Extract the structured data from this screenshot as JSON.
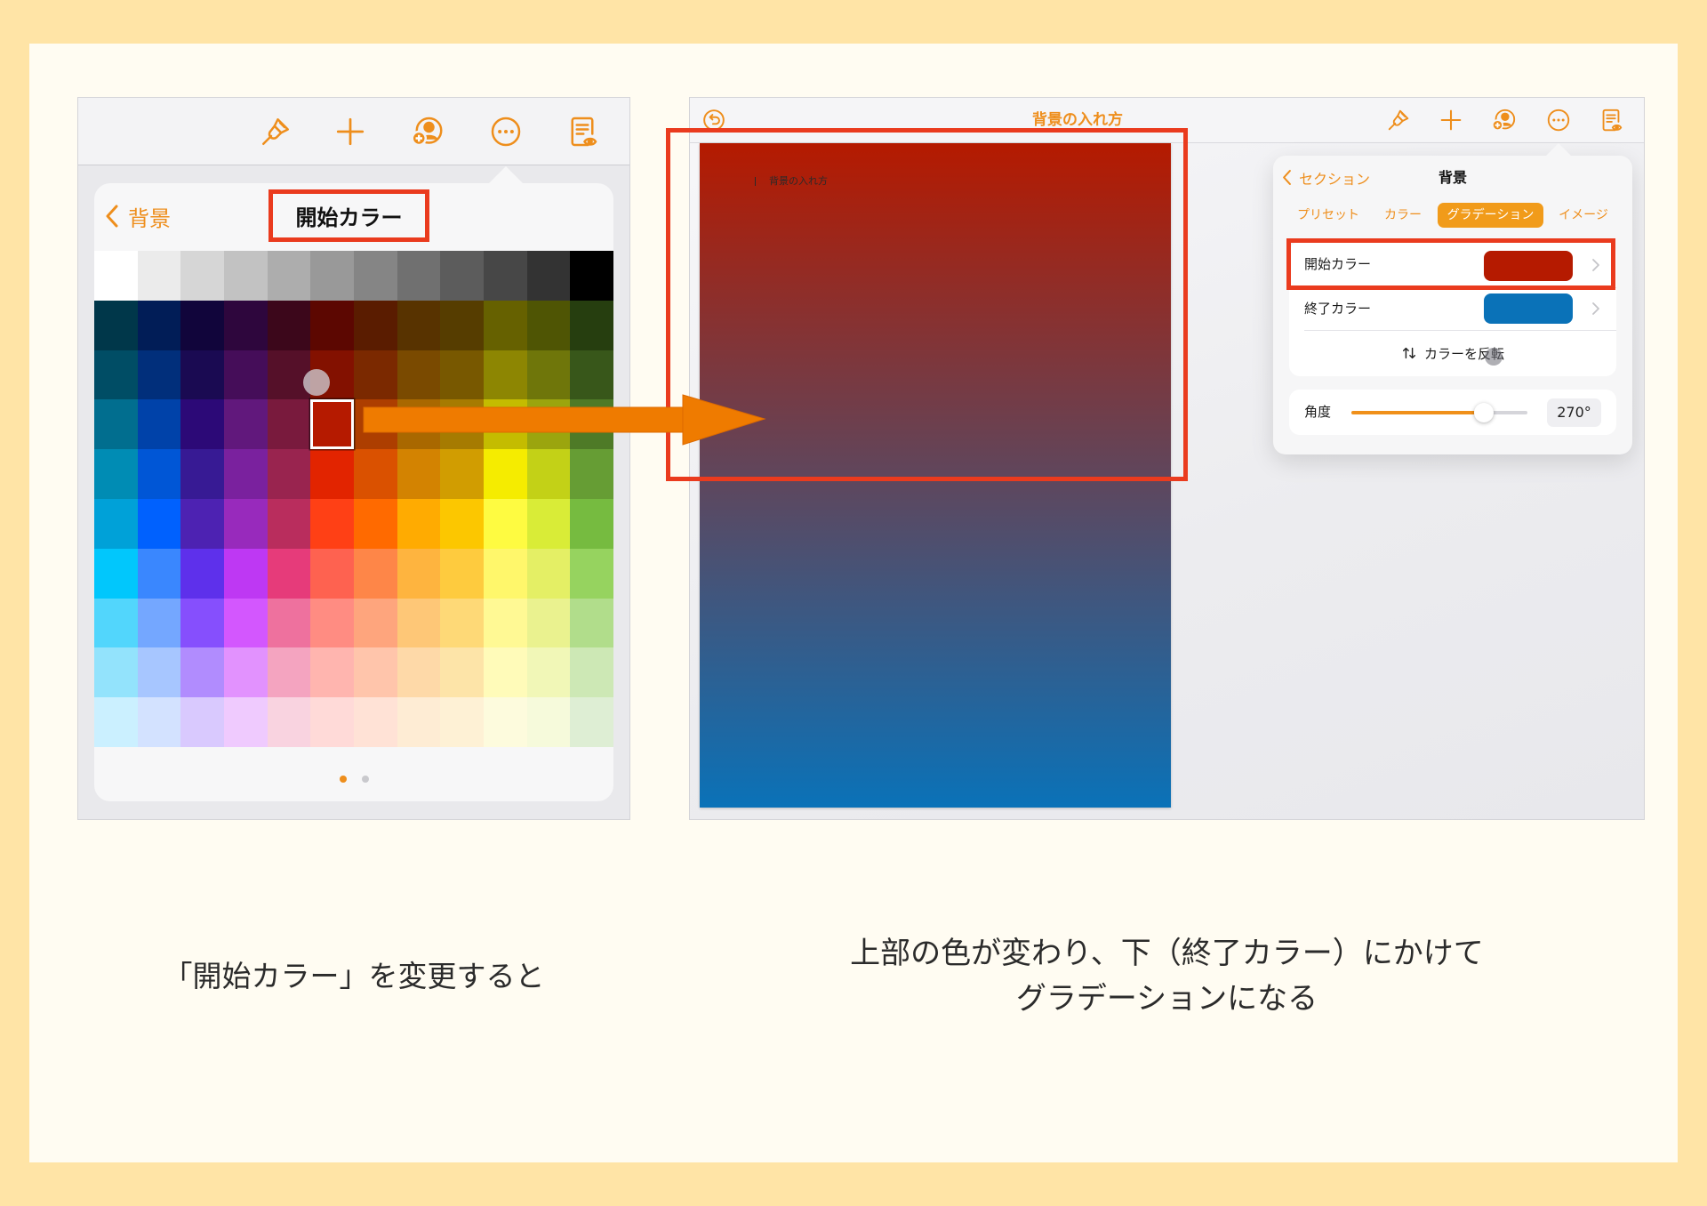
{
  "colors": {
    "accent": "#EE8E1C",
    "highlight": "#EA3B1E",
    "arrow": "#EF7B00",
    "frame": "#FFE4A6",
    "card": "#FFFCF2"
  },
  "left_panel": {
    "toolbar": {
      "icons": [
        "paintbrush-icon",
        "plus-icon",
        "collaborate-icon",
        "more-icon",
        "document-view-icon"
      ]
    },
    "popover": {
      "back_label": "背景",
      "title": "開始カラー"
    },
    "color_grid": {
      "rows": [
        [
          "#FFFFFF",
          "#EBEBEB",
          "#D6D6D6",
          "#C2C2C2",
          "#ADADAD",
          "#999999",
          "#858585",
          "#707070",
          "#5C5C5C",
          "#474747",
          "#333333",
          "#000000"
        ],
        [
          "#00374A",
          "#011D57",
          "#11053B",
          "#2E063D",
          "#3C071B",
          "#5C0701",
          "#5A1C00",
          "#583300",
          "#563D00",
          "#666100",
          "#4F5504",
          "#263E0F"
        ],
        [
          "#004D65",
          "#012F7B",
          "#1A0A52",
          "#450D59",
          "#551029",
          "#831100",
          "#7B2900",
          "#7A4A00",
          "#785800",
          "#8D8602",
          "#6F760A",
          "#38571A"
        ],
        [
          "#016E8F",
          "#0042A9",
          "#2C0977",
          "#61187C",
          "#791A3D",
          "#B51A00",
          "#AD3E00",
          "#A96800",
          "#A67B01",
          "#C4BC00",
          "#9BA50E",
          "#4E7A27"
        ],
        [
          "#008CB4",
          "#0056D6",
          "#371A94",
          "#7A219E",
          "#99244F",
          "#E22400",
          "#DA5100",
          "#D38301",
          "#D19D01",
          "#F5EC00",
          "#C3D117",
          "#669D34"
        ],
        [
          "#00A1D8",
          "#0061FE",
          "#4D22B2",
          "#982ABC",
          "#B92D5D",
          "#FF4015",
          "#FF6A00",
          "#FFAB01",
          "#FCC700",
          "#FEFB41",
          "#D9EC37",
          "#76BB40"
        ],
        [
          "#01C7FC",
          "#3A87FE",
          "#5E30EB",
          "#BE38F3",
          "#E63B7A",
          "#FE6250",
          "#FE8648",
          "#FEB43F",
          "#FECB3E",
          "#FFF76B",
          "#E4EF65",
          "#96D35F"
        ],
        [
          "#52D6FC",
          "#74A7FF",
          "#864FFD",
          "#D357FE",
          "#EE719E",
          "#FF8C82",
          "#FEA57D",
          "#FEC777",
          "#FED977",
          "#FFF994",
          "#EAF28F",
          "#B1DD8B"
        ],
        [
          "#93E3FC",
          "#A7C6FF",
          "#B18CFE",
          "#E292FE",
          "#F4A4C0",
          "#FFB5AF",
          "#FFC5AB",
          "#FED9A8",
          "#FDE4A8",
          "#FFFBB9",
          "#F1F7B7",
          "#CDE8B5"
        ],
        [
          "#CBF0FF",
          "#D3E2FF",
          "#D9C9FE",
          "#EFCAFE",
          "#F9D3E0",
          "#FFDAD8",
          "#FFE2D6",
          "#FEECD4",
          "#FEF1D5",
          "#FDFBDD",
          "#F6FADB",
          "#DEEED4"
        ]
      ],
      "selected": {
        "row": 3,
        "col": 5
      }
    },
    "page_indicator": {
      "count": 2,
      "active": 0
    }
  },
  "right_panel": {
    "title": "背景の入れ方",
    "toolbar": {
      "icons": [
        "undo-icon",
        "paintbrush-icon",
        "plus-icon",
        "collaborate-icon",
        "more-icon",
        "document-view-icon"
      ]
    },
    "document": {
      "heading": "背景の入れ方"
    },
    "inspector": {
      "back_label": "セクション",
      "title": "背景",
      "tabs": [
        {
          "label": "プリセット",
          "selected": false
        },
        {
          "label": "カラー",
          "selected": false
        },
        {
          "label": "グラデーション",
          "selected": true
        },
        {
          "label": "イメージ",
          "selected": false
        }
      ],
      "start_color_label": "開始カラー",
      "start_color": "#B51A00",
      "end_color_label": "終了カラー",
      "end_color": "#0A72B8",
      "reverse_label": "カラーを反転",
      "angle_label": "角度",
      "angle_value": "270°"
    }
  },
  "captions": {
    "left": "「開始カラー」を変更すると",
    "right_line1": "上部の色が変わり、下（終了カラー）にかけて",
    "right_line2": "グラデーションになる"
  }
}
